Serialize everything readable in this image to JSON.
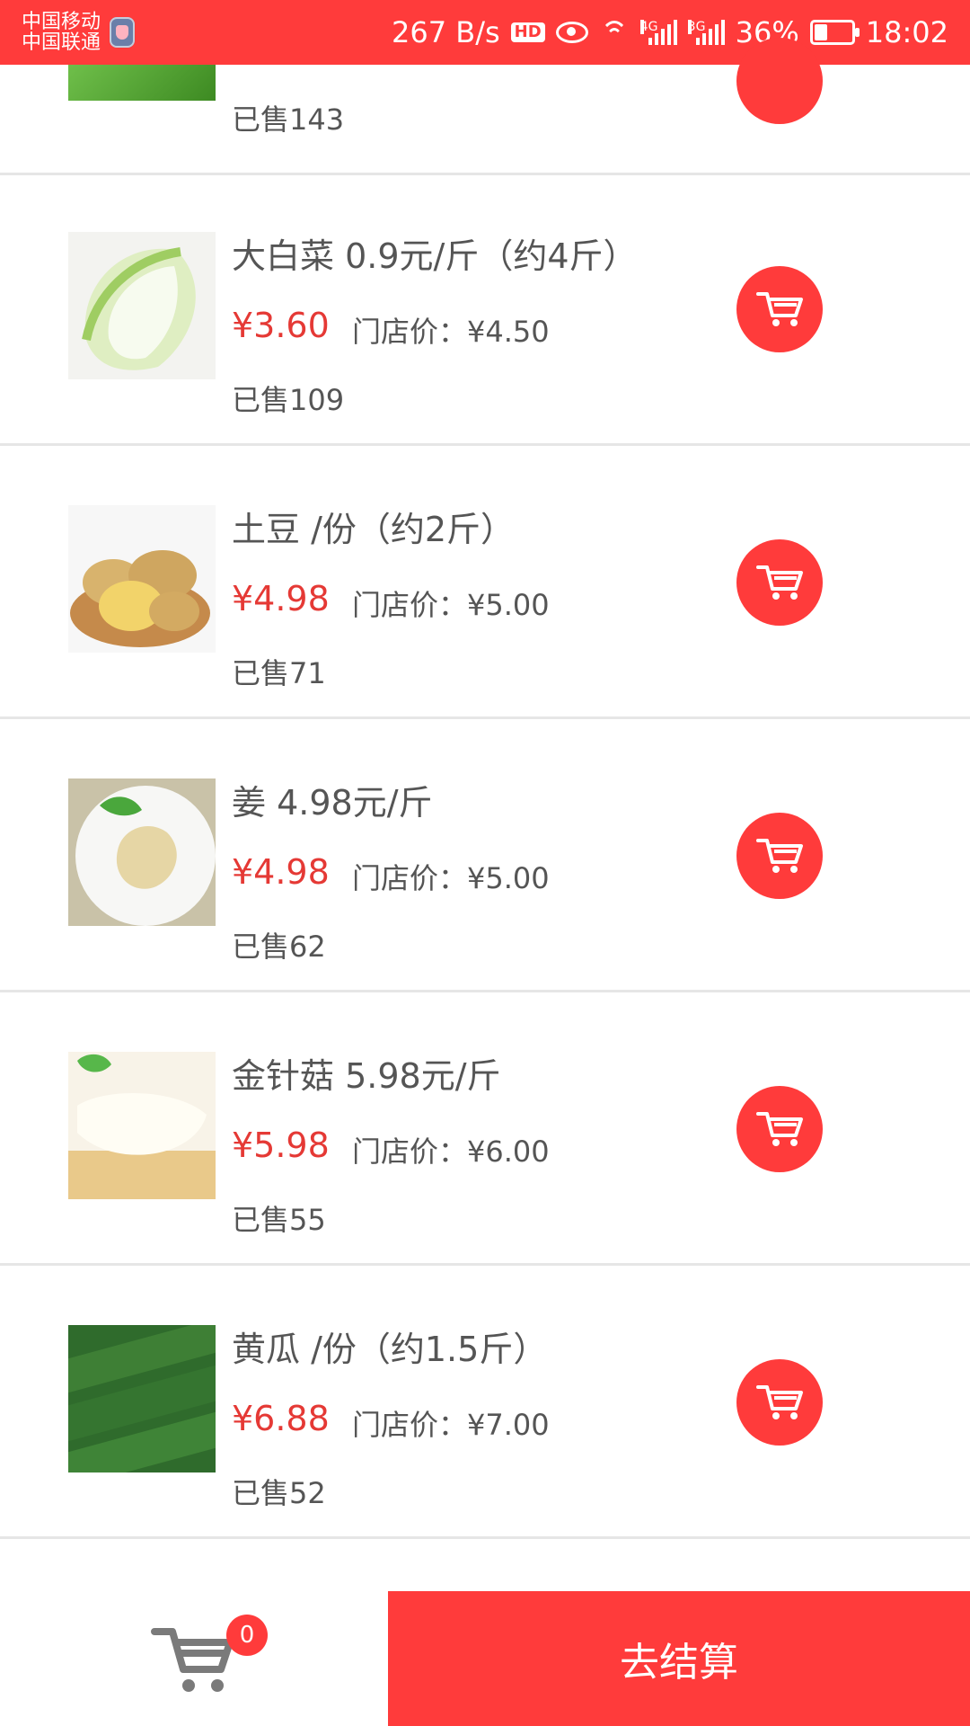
{
  "status_bar": {
    "carrier1": "中国移动",
    "carrier2": "中国联通",
    "net_speed": "267 B/s",
    "hd": "HD",
    "net1": "4G",
    "net2": "3G",
    "battery": "36%",
    "time": "18:02"
  },
  "partial_item": {
    "sold": "已售143"
  },
  "products": [
    {
      "title": "大白菜 0.9元/斤（约4斤）",
      "price": "¥3.60",
      "store_price": "门店价：¥4.50",
      "sold": "已售109",
      "thumb": "cabbage"
    },
    {
      "title": "土豆 /份（约2斤）",
      "price": "¥4.98",
      "store_price": "门店价：¥5.00",
      "sold": "已售71",
      "thumb": "potato"
    },
    {
      "title": "姜 4.98元/斤",
      "price": "¥4.98",
      "store_price": "门店价：¥5.00",
      "sold": "已售62",
      "thumb": "ginger"
    },
    {
      "title": "金针菇 5.98元/斤",
      "price": "¥5.98",
      "store_price": "门店价：¥6.00",
      "sold": "已售55",
      "thumb": "enoki"
    },
    {
      "title": "黄瓜 /份（约1.5斤）",
      "price": "¥6.88",
      "store_price": "门店价：¥7.00",
      "sold": "已售52",
      "thumb": "cucumber"
    }
  ],
  "bottom_bar": {
    "cart_count": "0",
    "checkout_label": "去结算"
  },
  "colors": {
    "accent": "#ff3b3b",
    "price": "#e53935",
    "text": "#555555",
    "divider": "#e6e6e6"
  }
}
